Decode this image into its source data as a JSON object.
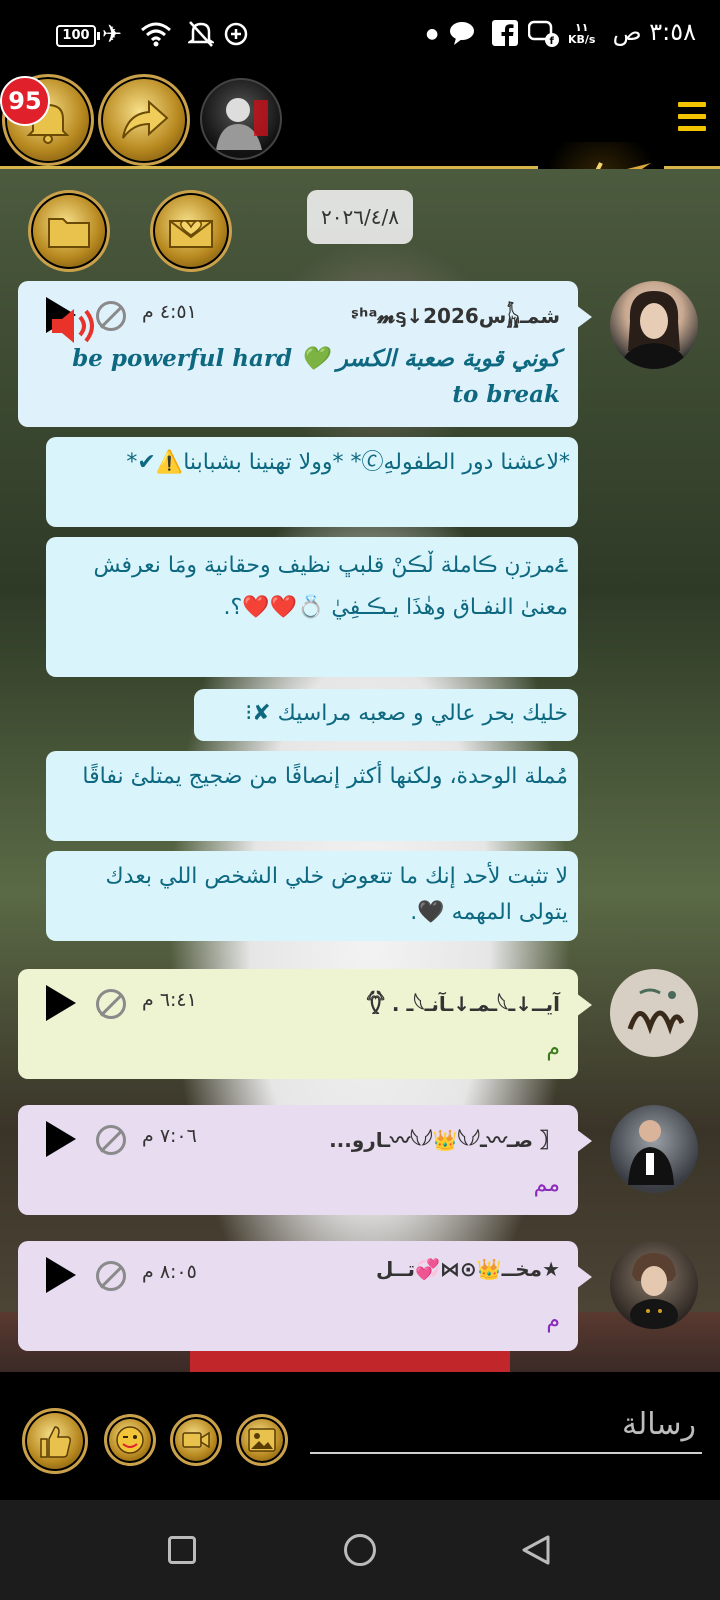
{
  "status_bar": {
    "time": "٣:٥٨ ص",
    "speed_value": "١١",
    "speed_unit": "KB/s",
    "battery": "100"
  },
  "top_bar": {
    "notification_count": "95"
  },
  "chat": {
    "date": "٢٠٢٦/٤/٨",
    "messages": [
      {
        "sender": "شمـ𓃱س2026↓ᶳʰᵃ𝓶ᶊ",
        "time": "٤:٥١ م",
        "text": "كوني قوية صعبة الكسر 💚 be powerful hard to break"
      },
      {
        "text": "*لاعشنا دور الطفولهِ🄫* *وولا تهنينا بشبابنا⚠️✔*"
      },
      {
        "text": "ۓمرڗڹ ڪاملة ڵڪنْ قلبڀ نظيف وحقانية ومَا نعرفش معنیٰ النفـاق وهٰذَا يـڪـفِيٰ 💍❤️❤️؟."
      },
      {
        "text": "خليك بحر عالي و صعبه مراسيك ✘⁝"
      },
      {
        "text": "مُملة الوحدة، ولكنها أكثر إنصافًا من ضجيج يمتلئ نفاقًا"
      },
      {
        "text": "لا تثبت لأحد إنك ما تتعوض خلي الشخص اللي بعدك يتولى المهمه 🖤."
      },
      {
        "sender": "آيــ↓ـ𓆩ـمـ↓ـآنـ𓆩ـ . 𓆫",
        "time": "٦:٤١ م",
        "text": "م"
      },
      {
        "sender": "〖 صـ〰ـ𓆩𓆪👑𓆩𓆪〰ـارو...",
        "time": "٧:٠٦ م",
        "text": "مم"
      },
      {
        "sender": "★مخــ👑⊙⋈💞تــل",
        "time": "٨:٠٥ م",
        "text": "م"
      }
    ]
  },
  "input": {
    "placeholder": "رسالة"
  },
  "colors": {
    "gold": "#d9b64b",
    "bubble_blue": "#dff2fb",
    "bubble_lavender": "#e8dcf0",
    "bubble_lime": "#eef4d2",
    "badge_red": "#e0202a"
  }
}
